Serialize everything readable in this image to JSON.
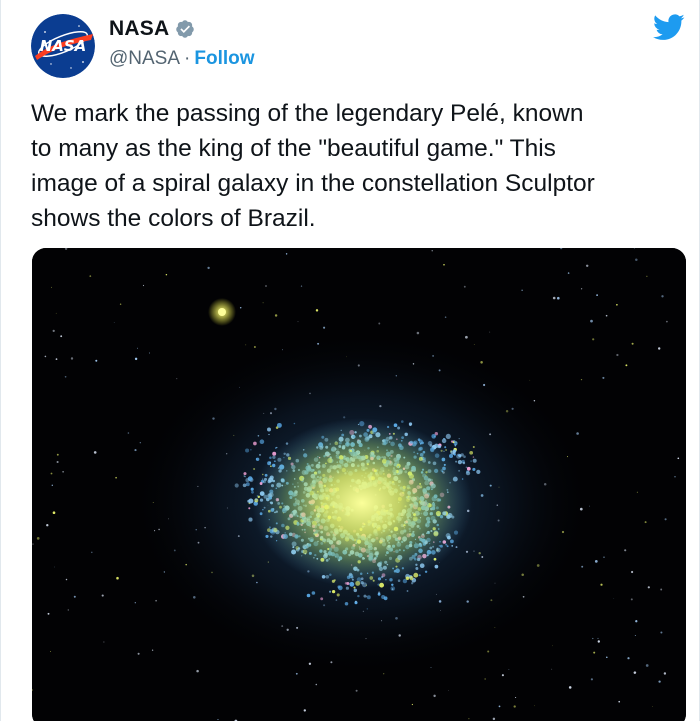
{
  "tweet": {
    "author": {
      "display_name": "NASA",
      "verified": true,
      "handle": "@NASA",
      "separator": "·",
      "follow_label": "Follow",
      "avatar_text": "NASA"
    },
    "text": "We mark the passing of the legendary Pelé, known\nto many as the king of the \"beautiful game.\" This\nimage of a spiral galaxy in the constellation Sculptor\nshows the colors of Brazil.",
    "media": {
      "type": "image",
      "subject": "spiral galaxy"
    }
  },
  "colors": {
    "twitter_blue": "#1d9bf0",
    "follow_link": "#1b95e0",
    "handle_gray": "#536471",
    "nasa_blue": "#0b3d91",
    "nasa_red": "#fc3d21",
    "galaxy_blue": "#5aa9e6",
    "galaxy_core": "#e8f56a",
    "galaxy_pink": "#f4a3d8"
  },
  "icons": {
    "brand": "twitter-bird-icon",
    "verified": "verified-badge-icon"
  }
}
